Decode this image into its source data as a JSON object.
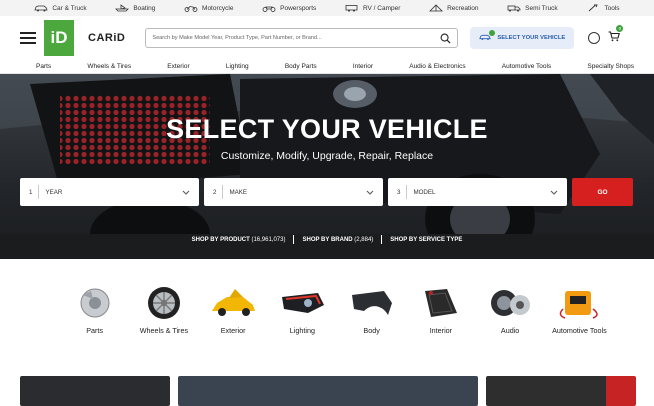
{
  "top_bar": {
    "items": [
      {
        "label": "Car & Truck",
        "icon": "car-icon"
      },
      {
        "label": "Boating",
        "icon": "boat-icon"
      },
      {
        "label": "Motorcycle",
        "icon": "motorcycle-icon"
      },
      {
        "label": "Powersports",
        "icon": "atv-icon"
      },
      {
        "label": "RV / Camper",
        "icon": "rv-icon"
      },
      {
        "label": "Recreation",
        "icon": "tent-icon"
      },
      {
        "label": "Semi Truck",
        "icon": "semi-truck-icon"
      },
      {
        "label": "Tools",
        "icon": "tools-icon"
      }
    ]
  },
  "header": {
    "logo_text": "iD",
    "brand": "CARiD",
    "search_placeholder": "Search by Make Model Year, Product Type, Part Number, or Brand...",
    "select_vehicle": "SELECT YOUR VEHICLE",
    "cart_count": "0",
    "accent_green": "#4ca83c",
    "accent_blue": "#2a5db0"
  },
  "nav": {
    "items": [
      "Parts",
      "Wheels & Tires",
      "Exterior",
      "Lighting",
      "Body Parts",
      "Interior",
      "Audio & Electronics",
      "Automotive Tools",
      "Specialty Shops"
    ]
  },
  "hero": {
    "title": "SELECT YOUR VEHICLE",
    "subtitle": "Customize, Modify, Upgrade, Repair, Replace",
    "selectors": [
      {
        "num": "1",
        "label": "YEAR"
      },
      {
        "num": "2",
        "label": "MAKE"
      },
      {
        "num": "3",
        "label": "MODEL"
      }
    ],
    "go": "GO",
    "go_color": "#d6201f",
    "shop_by": [
      {
        "label": "SHOP BY PRODUCT",
        "count": "(16,961,073)"
      },
      {
        "label": "SHOP BY BRAND",
        "count": "(2,884)"
      },
      {
        "label": "SHOP BY SERVICE TYPE",
        "count": ""
      }
    ]
  },
  "categories": [
    {
      "label": "Parts",
      "icon": "brake-rotor-icon"
    },
    {
      "label": "Wheels & Tires",
      "icon": "wheel-icon"
    },
    {
      "label": "Exterior",
      "icon": "car-exterior-icon"
    },
    {
      "label": "Lighting",
      "icon": "headlight-icon"
    },
    {
      "label": "Body",
      "icon": "fender-icon"
    },
    {
      "label": "Interior",
      "icon": "floor-mat-icon"
    },
    {
      "label": "Audio",
      "icon": "speaker-icon"
    },
    {
      "label": "Automotive Tools",
      "icon": "battery-charger-icon"
    }
  ]
}
